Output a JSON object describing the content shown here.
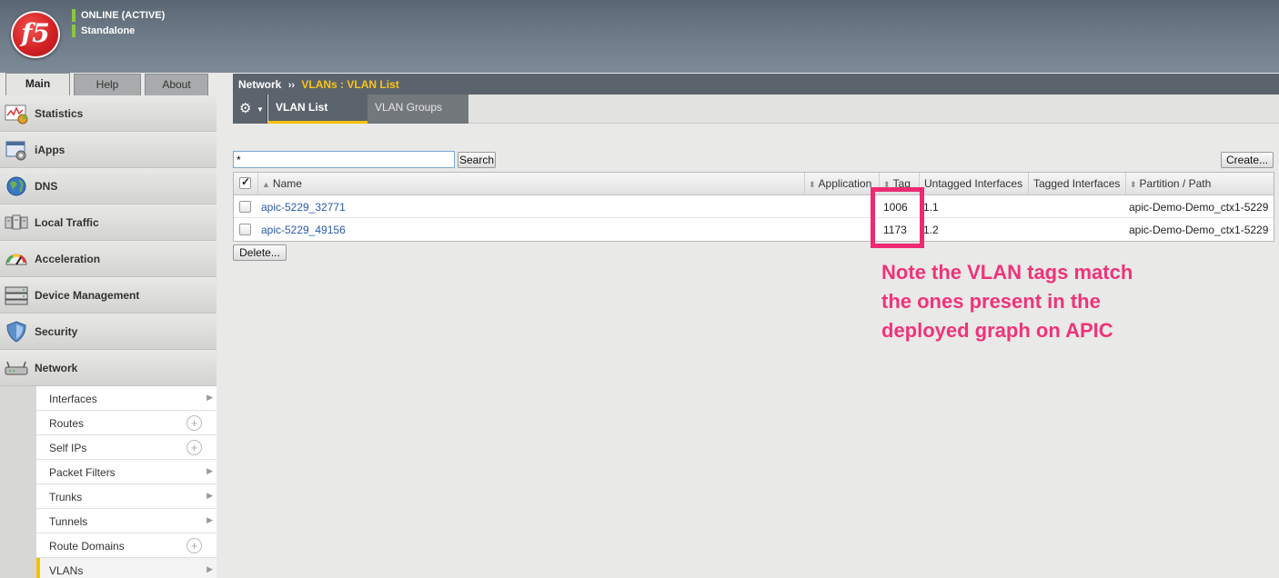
{
  "header": {
    "logo_text": "f5",
    "status_line1": "ONLINE (ACTIVE)",
    "status_line2": "Standalone"
  },
  "left_tabs": [
    "Main",
    "Help",
    "About"
  ],
  "sidebar": {
    "items": [
      {
        "label": "Statistics",
        "icon": "statistics-icon"
      },
      {
        "label": "iApps",
        "icon": "iapps-icon"
      },
      {
        "label": "DNS",
        "icon": "dns-globe-icon"
      },
      {
        "label": "Local Traffic",
        "icon": "local-traffic-icon"
      },
      {
        "label": "Acceleration",
        "icon": "acceleration-gauge-icon"
      },
      {
        "label": "Device Management",
        "icon": "device-management-icon"
      },
      {
        "label": "Security",
        "icon": "security-shield-icon"
      },
      {
        "label": "Network",
        "icon": "network-router-icon"
      }
    ],
    "network_subitems": [
      {
        "label": "Interfaces",
        "control": "arrow"
      },
      {
        "label": "Routes",
        "control": "plus"
      },
      {
        "label": "Self IPs",
        "control": "plus"
      },
      {
        "label": "Packet Filters",
        "control": "arrow"
      },
      {
        "label": "Trunks",
        "control": "arrow"
      },
      {
        "label": "Tunnels",
        "control": "arrow"
      },
      {
        "label": "Route Domains",
        "control": "plus"
      },
      {
        "label": "VLANs",
        "control": "arrow"
      }
    ]
  },
  "breadcrumb": {
    "section": "Network",
    "separator": "››",
    "current": "VLANs : VLAN List"
  },
  "toolbar": {
    "tabs": [
      "VLAN List",
      "VLAN Groups"
    ],
    "active_tab": "VLAN List"
  },
  "search": {
    "value": "*",
    "button_label": "Search"
  },
  "create_button": "Create...",
  "delete_button": "Delete...",
  "table": {
    "headers": {
      "name": "Name",
      "application": "Application",
      "tag": "Tag",
      "untagged": "Untagged Interfaces",
      "tagged": "Tagged Interfaces",
      "partition": "Partition / Path"
    },
    "rows": [
      {
        "name": "apic-5229_32771",
        "application": "",
        "tag": "1006",
        "untagged": "1.1",
        "tagged": "",
        "partition": "apic-Demo-Demo_ctx1-5229"
      },
      {
        "name": "apic-5229_49156",
        "application": "",
        "tag": "1173",
        "untagged": "1.2",
        "tagged": "",
        "partition": "apic-Demo-Demo_ctx1-5229"
      }
    ]
  },
  "annotation": {
    "line1": "Note the VLAN tags match",
    "line2": "the ones present in the",
    "line3": "deployed graph on APIC",
    "color": "#f0337a"
  }
}
